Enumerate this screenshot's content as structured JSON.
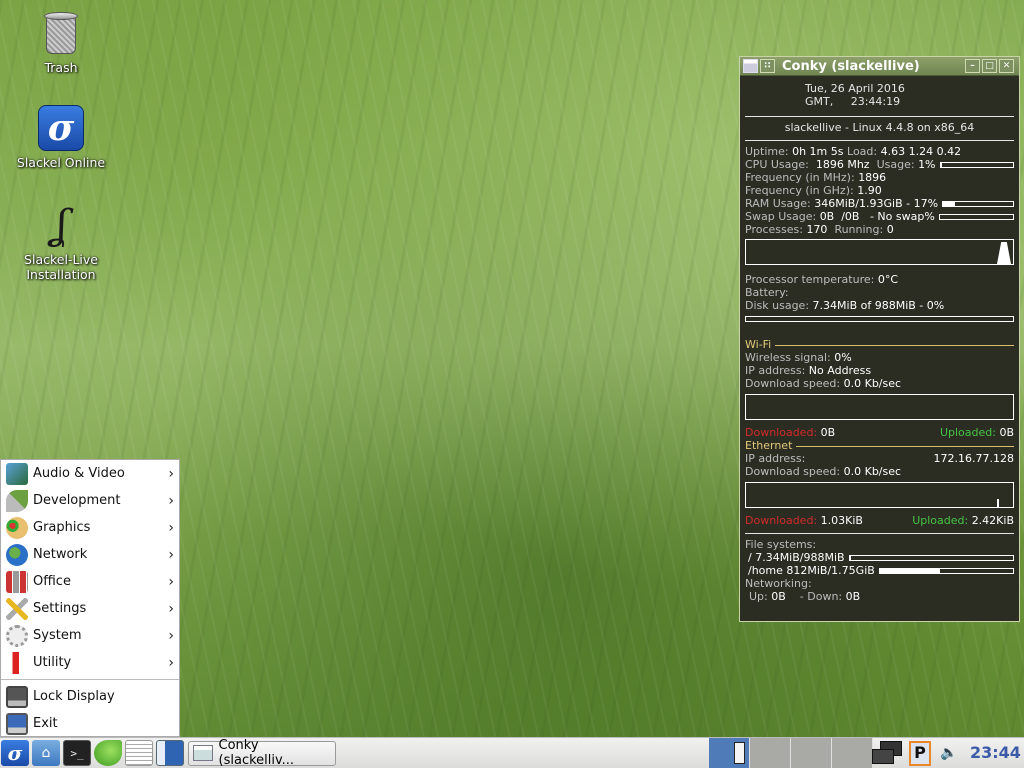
{
  "desktop": {
    "icons": [
      {
        "label": "Trash",
        "icon": "trash-icon"
      },
      {
        "label": "Slackel Online",
        "icon": "slackel-online-icon"
      },
      {
        "label_line1": "Slackel-Live",
        "label_line2": "Installation",
        "icon": "slackel-install-icon"
      }
    ]
  },
  "conky": {
    "title": "Conky (slackellive)",
    "date_line": "Tue,   26 April 2016",
    "time_line": "GMT,     23:44:19",
    "host_line": "slackellive - Linux 4.4.8 on x86_64",
    "uptime_label": "Uptime:",
    "uptime_value": "0h 1m 5s",
    "load_label": "Load:",
    "load_value": "4.63 1.24 0.42",
    "cpu_label": "CPU Usage:",
    "cpu_mhz": "1896 Mhz",
    "cpu_usage_label": "Usage:",
    "cpu_usage_value": "1%",
    "cpu_usage_fraction": 0.01,
    "freq_mhz_label": "Frequency (in MHz):",
    "freq_mhz_value": "1896",
    "freq_ghz_label": "Frequency (in GHz):",
    "freq_ghz_value": "1.90",
    "ram_label": "RAM Usage:",
    "ram_value": "346MiB/1.93GiB - 17%",
    "ram_fraction": 0.17,
    "swap_label": "Swap Usage:",
    "swap_value": "0B  /0B   - No swap%",
    "swap_fraction": 0,
    "processes_label": "Processes:",
    "processes_value": "170",
    "running_label": "Running:",
    "running_value": "0",
    "proc_temp_label": "Processor temperature:",
    "proc_temp_value": "0°C",
    "battery_label": "Battery:",
    "disk_label": "Disk usage:",
    "disk_value": "7.34MiB of 988MiB - 0%",
    "disk_fraction": 0.0,
    "wifi": {
      "header": "Wi-Fi",
      "signal_label": "Wireless signal:",
      "signal_value": "0%",
      "ip_label": "IP address:",
      "ip_value": "No Address",
      "dl_speed_label": "Download speed:",
      "dl_speed_value": "0.0 Kb/sec",
      "downloaded_label": "Downloaded:",
      "downloaded_value": "0B",
      "uploaded_label": "Uploaded:",
      "uploaded_value": "0B"
    },
    "ethernet": {
      "header": "Ethernet",
      "ip_label": "IP address:",
      "ip_value": "172.16.77.128",
      "dl_speed_label": "Download speed:",
      "dl_speed_value": "0.0 Kb/sec",
      "downloaded_label": "Downloaded:",
      "downloaded_value": "1.03KiB",
      "uploaded_label": "Uploaded:",
      "uploaded_value": "2.42KiB"
    },
    "fs_header": "File systems:",
    "fs_root": "/ 7.34MiB/988MiB",
    "fs_root_fraction": 0.007,
    "fs_home": "/home 812MiB/1.75GiB",
    "fs_home_fraction": 0.45,
    "networking_header": "Networking:",
    "net_up_label": "Up:",
    "net_up_value": "0B",
    "net_down_label": "- Down:",
    "net_down_value": "0B"
  },
  "menu": {
    "items": [
      {
        "label": "Audio & Video",
        "icon": "audio-video-icon",
        "submenu": true
      },
      {
        "label": "Development",
        "icon": "development-icon",
        "submenu": true
      },
      {
        "label": "Graphics",
        "icon": "graphics-icon",
        "submenu": true
      },
      {
        "label": "Network",
        "icon": "network-icon",
        "submenu": true
      },
      {
        "label": "Office",
        "icon": "office-icon",
        "submenu": true
      },
      {
        "label": "Settings",
        "icon": "settings-icon",
        "submenu": true
      },
      {
        "label": "System",
        "icon": "system-icon",
        "submenu": true
      },
      {
        "label": "Utility",
        "icon": "utility-icon",
        "submenu": true
      }
    ],
    "lock_label": "Lock Display",
    "exit_label": "Exit",
    "arrow": "›"
  },
  "taskbar": {
    "task_label": "Conky (slackelliv...",
    "pager_desktops": 4,
    "active_desktop": 1,
    "tray_p_label": "P",
    "clock": "23:44"
  }
}
